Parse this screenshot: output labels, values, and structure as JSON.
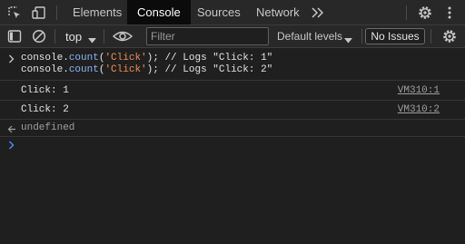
{
  "tabs": [
    {
      "label": "Elements"
    },
    {
      "label": "Console"
    },
    {
      "label": "Sources"
    },
    {
      "label": "Network"
    }
  ],
  "toolbar": {
    "context": "top",
    "filter_placeholder": "Filter",
    "levels": "Default levels",
    "issues": "No Issues"
  },
  "console": {
    "input_lines": [
      {
        "pre": "console.",
        "fn": "count",
        "open": "(",
        "arg": "'Click'",
        "rest": "); // Logs \"Click: 1\""
      },
      {
        "pre": "console.",
        "fn": "count",
        "open": "(",
        "arg": "'Click'",
        "rest": "); // Logs \"Click: 2\""
      }
    ],
    "outputs": [
      {
        "text": "Click: 1",
        "source": "VM310:1"
      },
      {
        "text": "Click: 2",
        "source": "VM310:2"
      }
    ],
    "return_value": "undefined"
  },
  "icons": [
    "inspect-element-icon",
    "device-toggle-icon",
    "more-tabs-icon",
    "settings-icon",
    "kebab-menu-icon",
    "sidebar-toggle-icon",
    "clear-console-icon",
    "dropdown-arrow-icon",
    "live-expression-eye-icon",
    "console-settings-icon",
    "input-chevron-icon",
    "return-value-icon",
    "prompt-chevron-icon"
  ],
  "colors": {
    "background": "#1f1f1f",
    "toolbar": "#282828",
    "active_tab": "#0b0b0b",
    "string": "#f28b54",
    "function": "#8ab4f8",
    "prompt": "#4c8ef7"
  }
}
